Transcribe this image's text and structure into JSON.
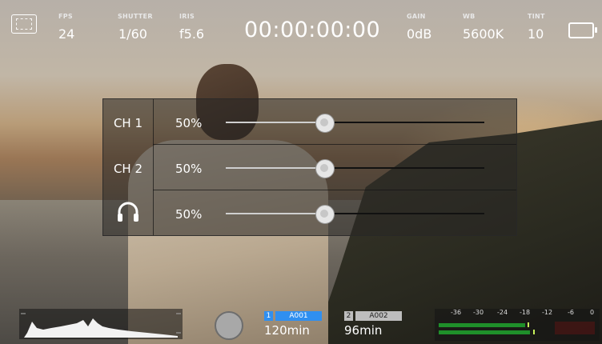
{
  "top_bar": {
    "fps_label": "FPS",
    "fps_value": "24",
    "shutter_label": "SHUTTER",
    "shutter_value": "1/60",
    "iris_label": "IRIS",
    "iris_value": "f5.6",
    "timecode": "00:00:00:00",
    "gain_label": "GAIN",
    "gain_value": "0dB",
    "wb_label": "WB",
    "wb_value": "5600K",
    "tint_label": "TINT",
    "tint_value": "10"
  },
  "audio_panel": {
    "channels": [
      {
        "label": "CH 1",
        "level_text": "50%",
        "level": 0.38
      },
      {
        "label": "CH 2",
        "level_text": "50%",
        "level": 0.38
      },
      {
        "icon": "headphones-icon",
        "level_text": "50%",
        "level": 0.38
      }
    ]
  },
  "bottom_bar": {
    "card1": {
      "slot": "1",
      "name": "A001",
      "time": "120min",
      "active_color": "#2f8ff0"
    },
    "card2": {
      "slot": "2",
      "name": "A002",
      "time": "96min",
      "inactive_color": "#bdbdbd"
    },
    "meter_scale": [
      "-36",
      "-30",
      "-24",
      "-18",
      "-12",
      "-6",
      "0"
    ]
  },
  "colors": {
    "accent_blue": "#2f8ff0",
    "meter_green": "#1f8f2a"
  }
}
